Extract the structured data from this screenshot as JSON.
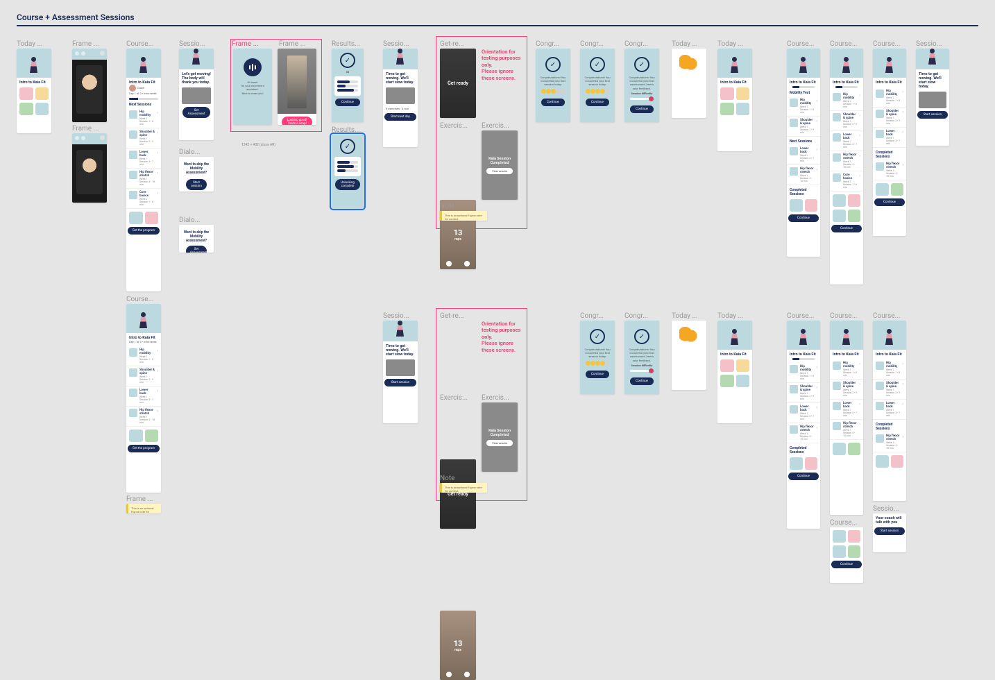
{
  "header": {
    "title": "Course + Assessment Sessions"
  },
  "labels": {
    "today": "Today ...",
    "frame": "Frame ...",
    "course": "Course...",
    "session": "Sessio...",
    "dialog": "Dialo...",
    "results": "Results...",
    "getready": "Get-re...",
    "exercise": "Exercis...",
    "note": "Note",
    "congr": "Congr..."
  },
  "common": {
    "intro_title": "Intro to Kaia Fit",
    "get_moving": "Let's get moving! The body will thank you today.",
    "time_to_move": "Time to get moving. We'll start slow today.",
    "continue": "Continue",
    "start_session": "Start session",
    "start_next_day": "Start next day",
    "get_program": "Get the program",
    "set_assessment": "Set Assessment",
    "unlock_complete": "Unlocking complete",
    "get_ready": "Get ready",
    "reps": "13",
    "reps_label": "reps",
    "completed_title": "Kaia Session Completed",
    "view_results": "View results",
    "congrats_msg": "Congratulations! You completed your first session today.",
    "congrats_msg2": "Congratulations! You completed your first assessment, here's your feedback.",
    "difficulty": "Session difficulty",
    "skip_q": "Want to skip the Mobility Assessment?",
    "want_skip": "Want to skip the Mobility Assessment?",
    "hi_msg": "Hi there!\nI'm your movement assistant.\nNice to meet you!",
    "looks_great": "Looking good! That's a wrap!",
    "score": "53",
    "mobility": "Mobility Test",
    "next_sessions": "Next Sessions",
    "completed_sessions": "Completed Sessions",
    "day_label": "Day 1 of 3 • Intro week",
    "coach_today": "Your coach will talk with you"
  },
  "warn": {
    "line1": "Orientation for testing purposes only.",
    "line2": "Please ignore these screens."
  },
  "note_text": "This is an optional Figma note for context.",
  "sessions": [
    {
      "title": "Hip mobility",
      "sub": "Week 1 Session 1 • 8 min"
    },
    {
      "title": "Shoulder & spine",
      "sub": "Week 1 Session 2 • 9 min"
    },
    {
      "title": "Lower back",
      "sub": "Week 1 Session 3 • 7 min"
    },
    {
      "title": "Hip flexor stretch",
      "sub": "Week 1 Session 4 • 10 min"
    },
    {
      "title": "Core basics",
      "sub": "Week 2 Session 1 • 8 min"
    }
  ]
}
